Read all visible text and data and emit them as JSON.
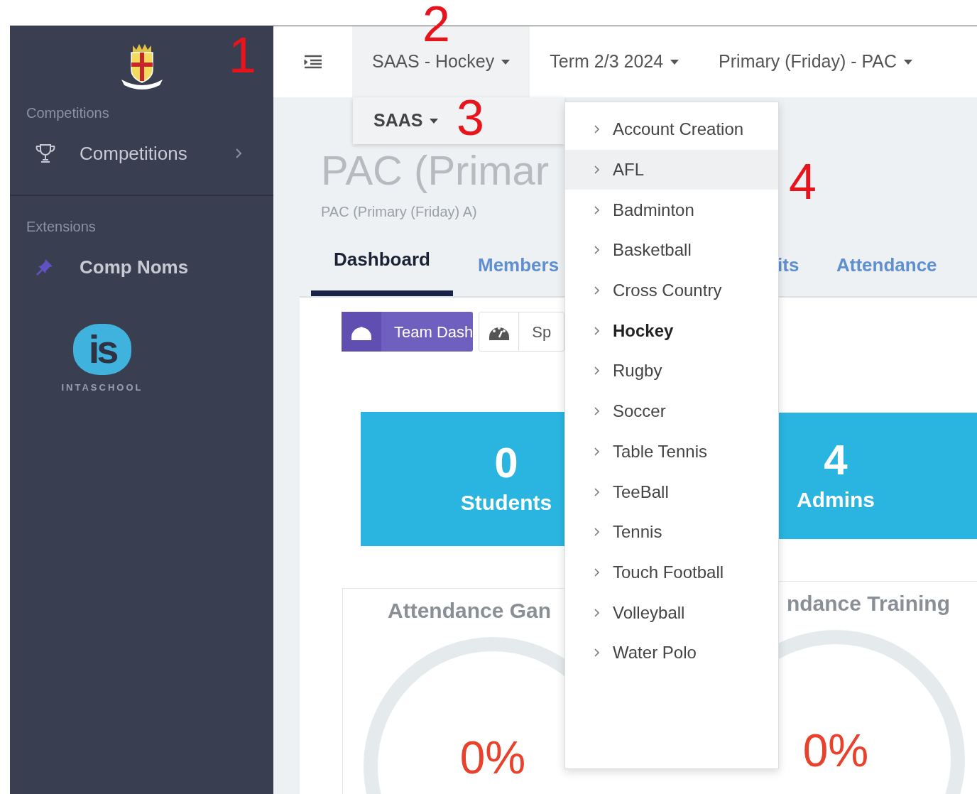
{
  "annotations": [
    "1",
    "2",
    "3",
    "4"
  ],
  "sidebar": {
    "sections": [
      {
        "title": "Competitions",
        "items": [
          {
            "label": "Competitions",
            "kind": "trophy",
            "expandable": true,
            "selected": false
          }
        ]
      },
      {
        "title": "Extensions",
        "items": [
          {
            "label": "Comp Noms",
            "kind": "pin",
            "expandable": false,
            "selected": true
          }
        ]
      }
    ],
    "brand": {
      "mark": "is",
      "wordmark": "INTASCHOOL"
    }
  },
  "topbar": {
    "menus": [
      {
        "label": "SAAS - Hockey",
        "selected": true
      },
      {
        "label": "Term 2/3 2024",
        "selected": false
      },
      {
        "label": "Primary (Friday) - PAC",
        "selected": false
      }
    ]
  },
  "submenu": {
    "label": "SAAS"
  },
  "dropdown": {
    "items": [
      {
        "label": "Account Creation",
        "selected": false,
        "highlighted": false
      },
      {
        "label": "AFL",
        "selected": false,
        "highlighted": true
      },
      {
        "label": "Badminton",
        "selected": false,
        "highlighted": false
      },
      {
        "label": "Basketball",
        "selected": false,
        "highlighted": false
      },
      {
        "label": "Cross Country",
        "selected": false,
        "highlighted": false
      },
      {
        "label": "Hockey",
        "selected": true,
        "highlighted": false
      },
      {
        "label": "Rugby",
        "selected": false,
        "highlighted": false
      },
      {
        "label": "Soccer",
        "selected": false,
        "highlighted": false
      },
      {
        "label": "Table Tennis",
        "selected": false,
        "highlighted": false
      },
      {
        "label": "TeeBall",
        "selected": false,
        "highlighted": false
      },
      {
        "label": "Tennis",
        "selected": false,
        "highlighted": false
      },
      {
        "label": "Touch Football",
        "selected": false,
        "highlighted": false
      },
      {
        "label": "Volleyball",
        "selected": false,
        "highlighted": false
      },
      {
        "label": "Water Polo",
        "selected": false,
        "highlighted": false
      }
    ]
  },
  "page": {
    "title": "PAC (Primar",
    "subtitle": "PAC (Primary (Friday) A)",
    "tabs": [
      {
        "label": "Dashboard",
        "selected": true
      },
      {
        "label": "Members",
        "selected": false
      },
      {
        "label": "its",
        "selected": false
      },
      {
        "label": "Attendance",
        "selected": false
      }
    ],
    "view_buttons": [
      {
        "label": "Team Dash",
        "selected": true
      },
      {
        "label": "Sp",
        "selected": false
      }
    ],
    "stats": [
      {
        "value": "0",
        "label": "Students"
      },
      {
        "value": "4",
        "label": "Admins"
      }
    ],
    "gauges": [
      {
        "title": "Attendance Gan",
        "value": "0%"
      },
      {
        "title": "ndance Training",
        "value": "0%"
      }
    ]
  }
}
